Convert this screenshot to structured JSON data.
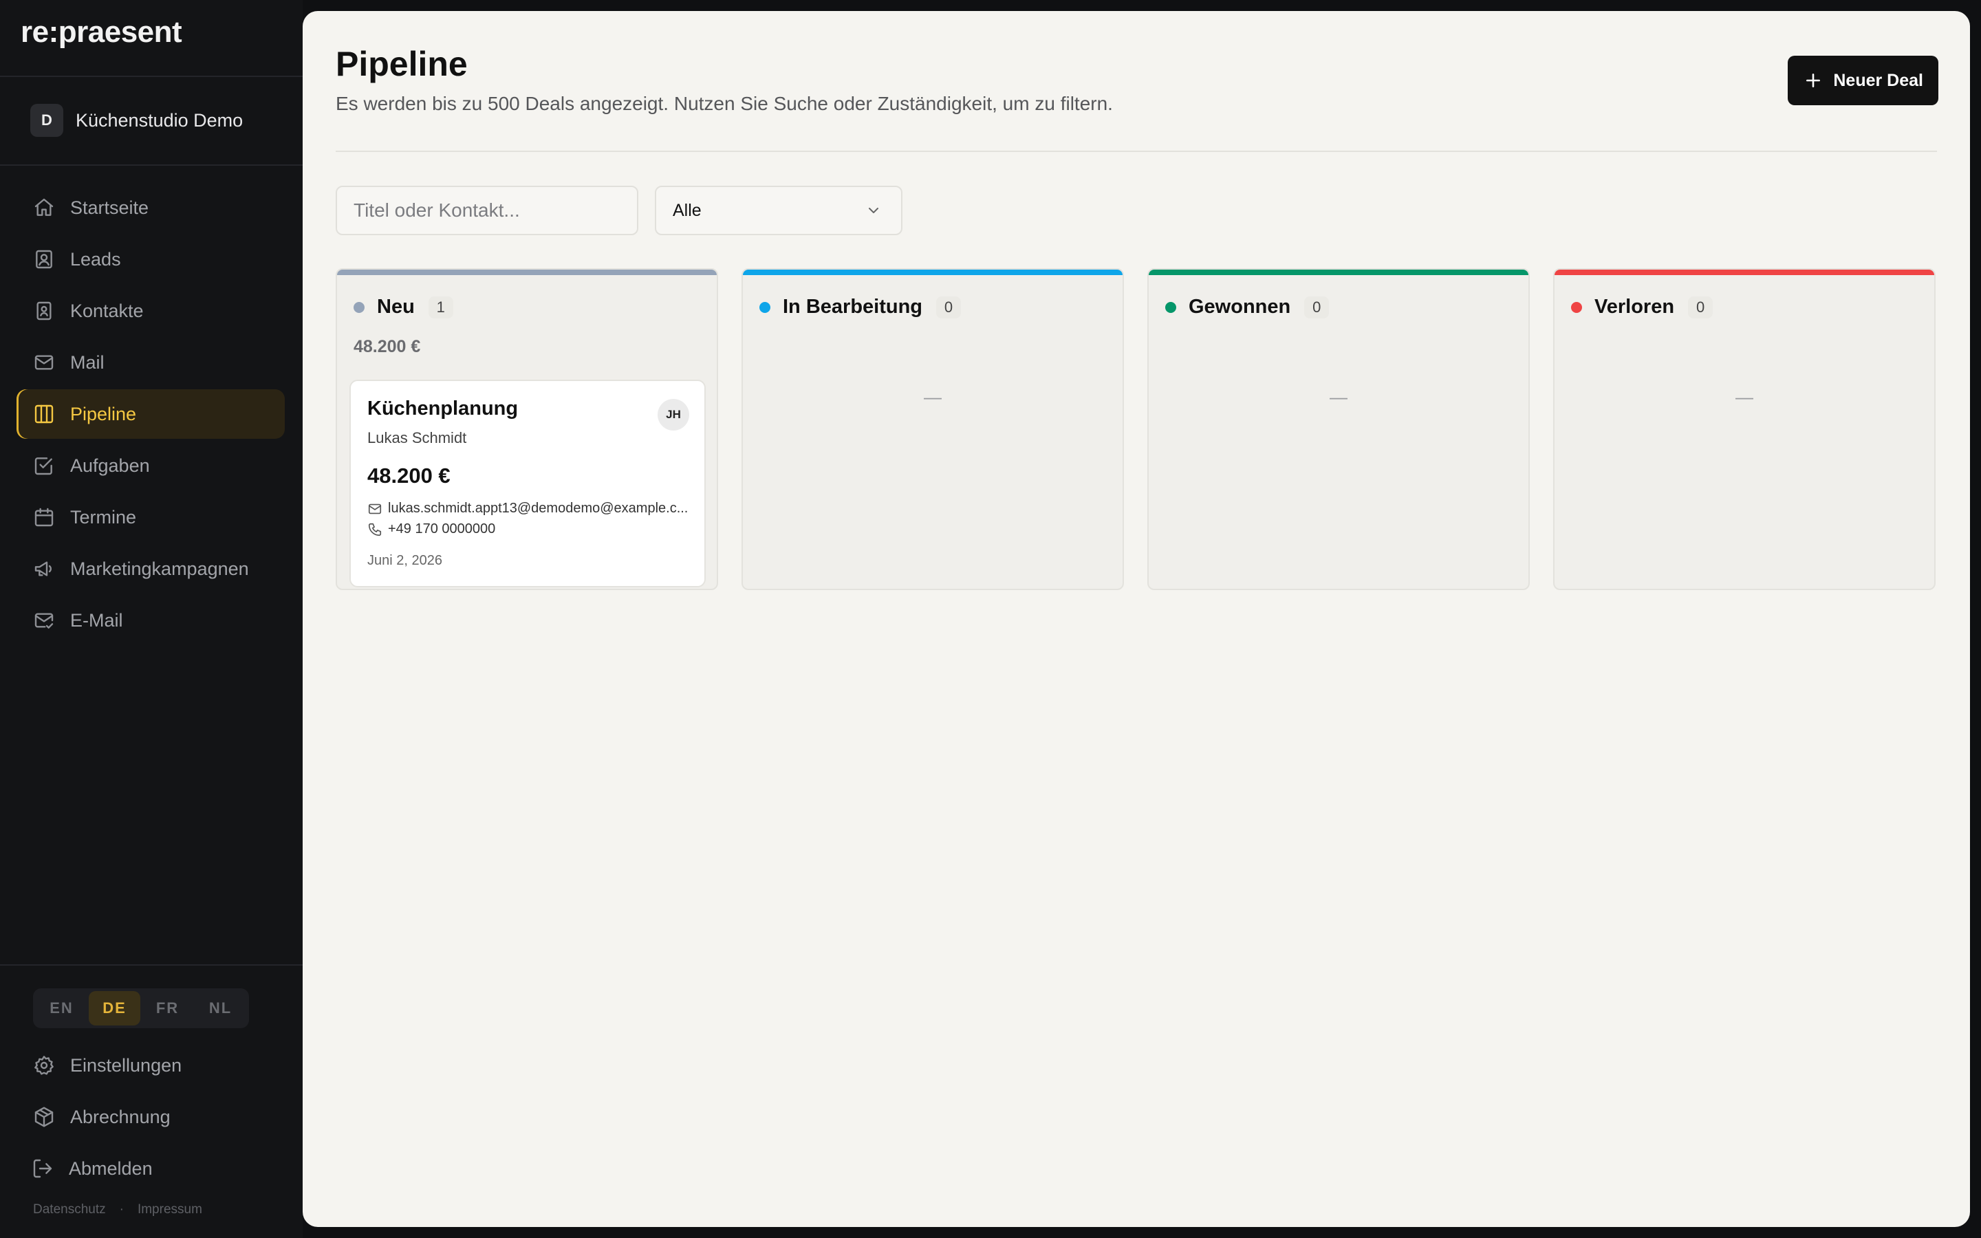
{
  "app": {
    "logo": "re:praesent"
  },
  "workspace": {
    "initial": "D",
    "name": "Küchenstudio Demo"
  },
  "nav": [
    {
      "label": "Startseite",
      "icon": "home-icon"
    },
    {
      "label": "Leads",
      "icon": "contact-card-icon"
    },
    {
      "label": "Kontakte",
      "icon": "address-book-icon"
    },
    {
      "label": "Mail",
      "icon": "mail-icon"
    },
    {
      "label": "Pipeline",
      "icon": "columns-icon",
      "active": true
    },
    {
      "label": "Aufgaben",
      "icon": "checkbox-icon"
    },
    {
      "label": "Termine",
      "icon": "calendar-icon"
    },
    {
      "label": "Marketingkampagnen",
      "icon": "megaphone-icon"
    },
    {
      "label": "E-Mail",
      "icon": "mail-check-icon"
    }
  ],
  "languages": [
    "EN",
    "DE",
    "FR",
    "NL"
  ],
  "active_language": "DE",
  "bottom_nav": [
    {
      "label": "Einstellungen",
      "icon": "gear-icon"
    },
    {
      "label": "Abrechnung",
      "icon": "package-icon"
    },
    {
      "label": "Abmelden",
      "icon": "logout-icon"
    }
  ],
  "footer": {
    "privacy": "Datenschutz",
    "separator": "·",
    "imprint": "Impressum"
  },
  "header": {
    "title": "Pipeline",
    "subtitle": "Es werden bis zu 500 Deals angezeigt. Nutzen Sie Suche oder Zuständigkeit, um zu filtern.",
    "new_deal_label": "Neuer Deal"
  },
  "filters": {
    "search_placeholder": "Titel oder Kontakt...",
    "search_value": "",
    "owner_selected": "Alle"
  },
  "columns": [
    {
      "title": "Neu",
      "count": "1",
      "sum": "48.200 €",
      "color": "#94a3b8"
    },
    {
      "title": "In Bearbeitung",
      "count": "0",
      "empty": "—",
      "color": "#0ea5e9"
    },
    {
      "title": "Gewonnen",
      "count": "0",
      "empty": "—",
      "color": "#059669"
    },
    {
      "title": "Verloren",
      "count": "0",
      "empty": "—",
      "color": "#ef4444"
    }
  ],
  "deal_card": {
    "title": "Küchenplanung",
    "contact": "Lukas Schmidt",
    "owner_initials": "JH",
    "amount": "48.200 €",
    "email": "lukas.schmidt.appt13@demodemo@example.c...",
    "phone": "+49 170 0000000",
    "date": "Juni 2, 2026"
  }
}
